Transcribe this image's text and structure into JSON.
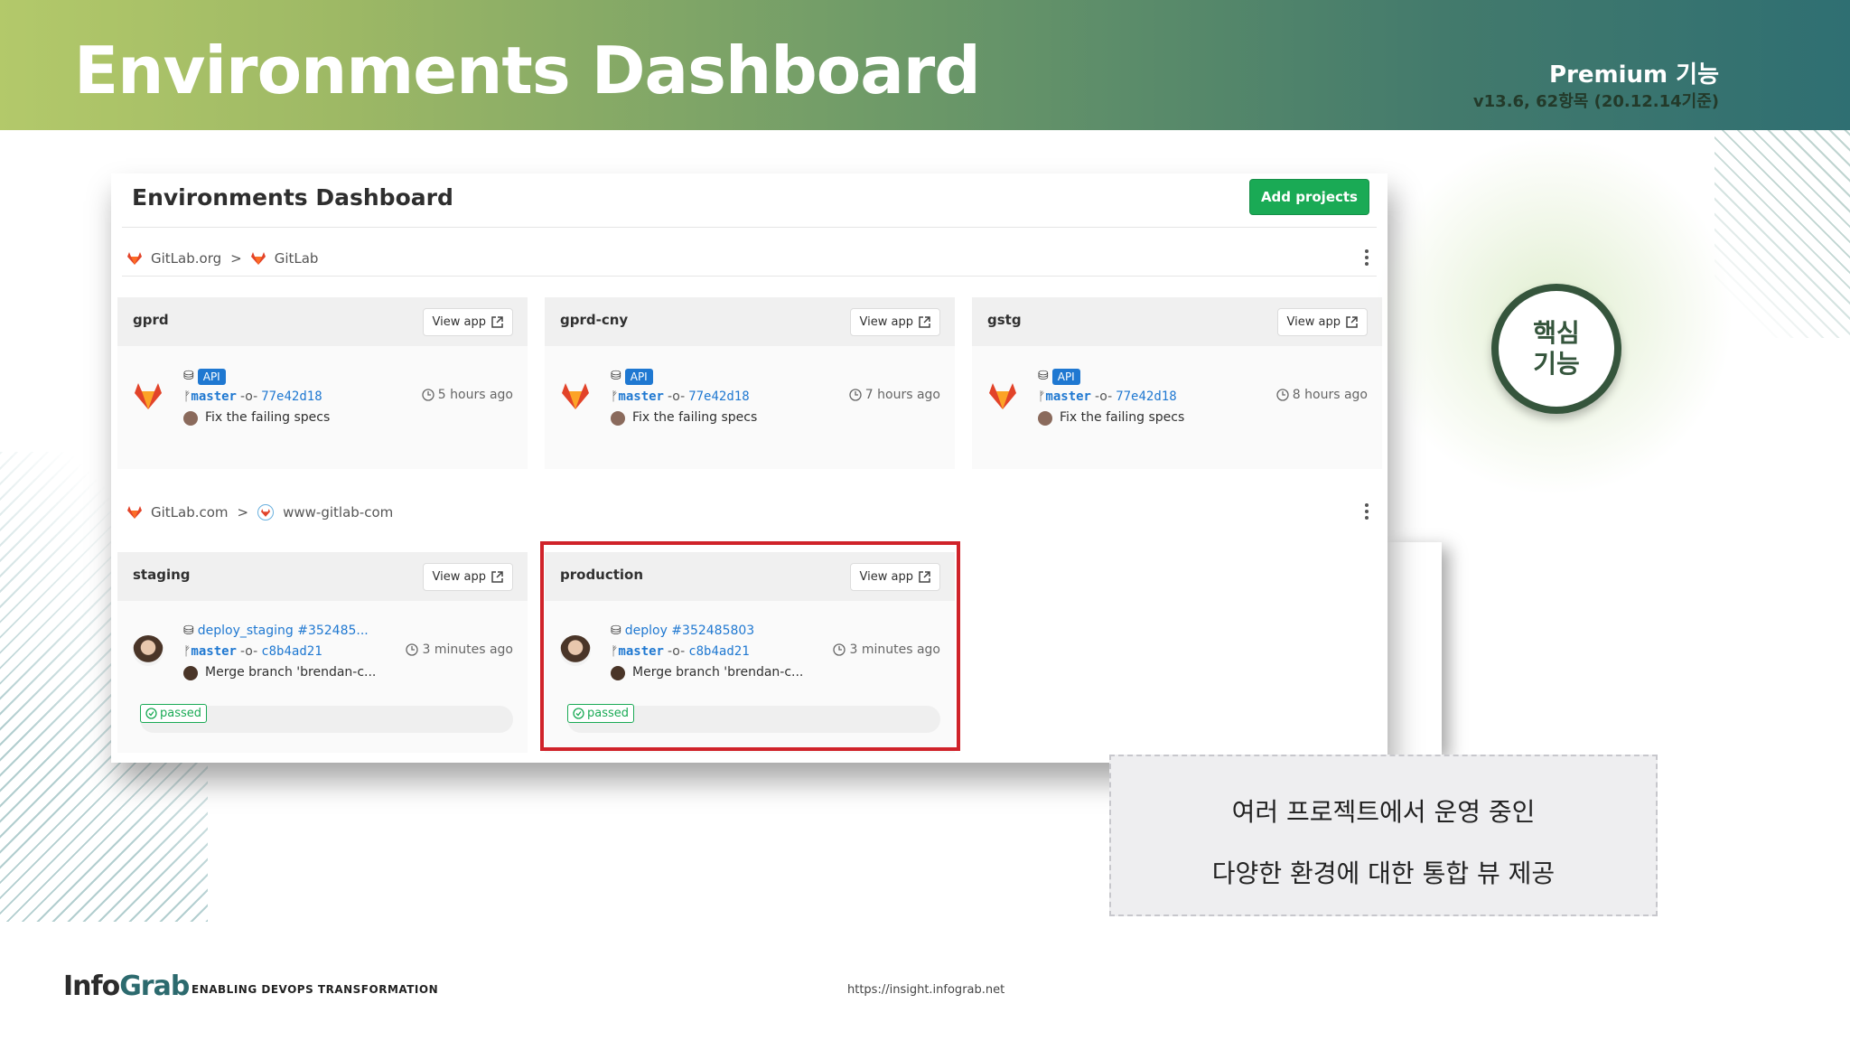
{
  "slide": {
    "title": "Environments Dashboard",
    "tier": "Premium 기능",
    "version": "v13.6, 62항목 (20.12.14기준)"
  },
  "dashboard": {
    "title": "Environments Dashboard",
    "add_button": "Add projects",
    "groups": [
      {
        "namespace": "GitLab.org",
        "project": "GitLab",
        "cards": [
          {
            "env": "gprd",
            "view_app": "View app",
            "api_label": "API",
            "branch": "master",
            "sha": "77e42d18",
            "message": "Fix the failing specs",
            "time": "5 hours ago"
          },
          {
            "env": "gprd-cny",
            "view_app": "View app",
            "api_label": "API",
            "branch": "master",
            "sha": "77e42d18",
            "message": "Fix the failing specs",
            "time": "7 hours ago"
          },
          {
            "env": "gstg",
            "view_app": "View app",
            "api_label": "API",
            "branch": "master",
            "sha": "77e42d18",
            "message": "Fix the failing specs",
            "time": "8 hours ago"
          }
        ]
      },
      {
        "namespace": "GitLab.com",
        "project": "www-gitlab-com",
        "cards": [
          {
            "env": "staging",
            "view_app": "View app",
            "job": "deploy_staging #352485...",
            "branch": "master",
            "sha": "c8b4ad21",
            "message": "Merge branch 'brendan-c...",
            "time": "3 minutes ago",
            "status": "passed"
          },
          {
            "env": "production",
            "view_app": "View app",
            "job": "deploy #352485803",
            "branch": "master",
            "sha": "c8b4ad21",
            "message": "Merge branch 'brendan-c...",
            "time": "3 minutes ago",
            "status": "passed"
          }
        ]
      }
    ]
  },
  "core_badge": "핵심\n기능",
  "callout": {
    "line1": "여러 프로젝트에서 운영 중인",
    "line2": "다양한 환경에 대한 통합 뷰 제공"
  },
  "footer": {
    "logo_info": "Info",
    "logo_grab": "Grab",
    "tagline": "ENABLING DEVOPS TRANSFORMATION",
    "url": "https://insight.infograb.net"
  },
  "colors": {
    "accent_green": "#1aaa55",
    "link_blue": "#1f78d1",
    "highlight_red": "#d0232a",
    "badge_green": "#35553c"
  }
}
